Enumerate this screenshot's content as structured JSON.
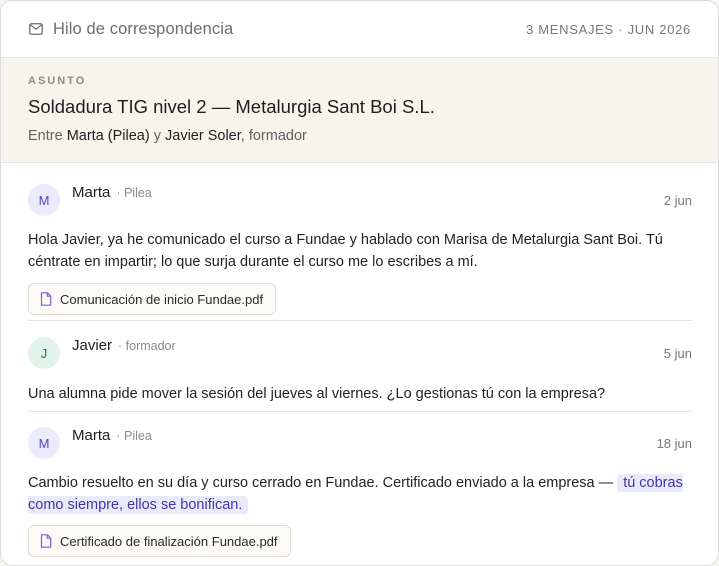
{
  "header": {
    "title": "Hilo de correspondencia",
    "meta": "3 MENSAJES · JUN 2026",
    "icon": "mail-icon"
  },
  "subject": {
    "label": "ASUNTO",
    "title": "Soldadura TIG nivel 2 — Metalurgia Sant Boi S.L.",
    "parties_prefix": "Entre ",
    "party_a": "Marta (Pilea)",
    "parties_join": " y ",
    "party_b": "Javier Soler",
    "parties_suffix": ", formador"
  },
  "messages": [
    {
      "initial": "M",
      "author": "Marta",
      "role": "· Pilea",
      "date": "2 jun",
      "body": "Hola Javier, ya he comunicado el curso a Fundae y hablado con Marisa de Metalurgia Sant Boi. Tú céntrate en impartir; lo que surja durante el curso me lo escribes a mí.",
      "attachment": "Comunicación de inicio Fundae.pdf"
    },
    {
      "initial": "J",
      "author": "Javier",
      "role": "· formador",
      "date": "5 jun",
      "body": "Una alumna pide mover la sesión del jueves al viernes. ¿Lo gestionas tú con la empresa?"
    },
    {
      "initial": "M",
      "author": "Marta",
      "role": "· Pilea",
      "date": "18 jun",
      "body": "Cambio resuelto en su día y curso cerrado en Fundae. Certificado enviado a la empresa — ",
      "highlight": "tú cobras como siempre, ellos se bonifican.",
      "attachment": "Certificado de finalización Fundae.pdf"
    }
  ],
  "colors": {
    "accent": "#4f45c6",
    "subject_bg": "#f7f4ec",
    "highlight_bg": "#ebeafb"
  }
}
